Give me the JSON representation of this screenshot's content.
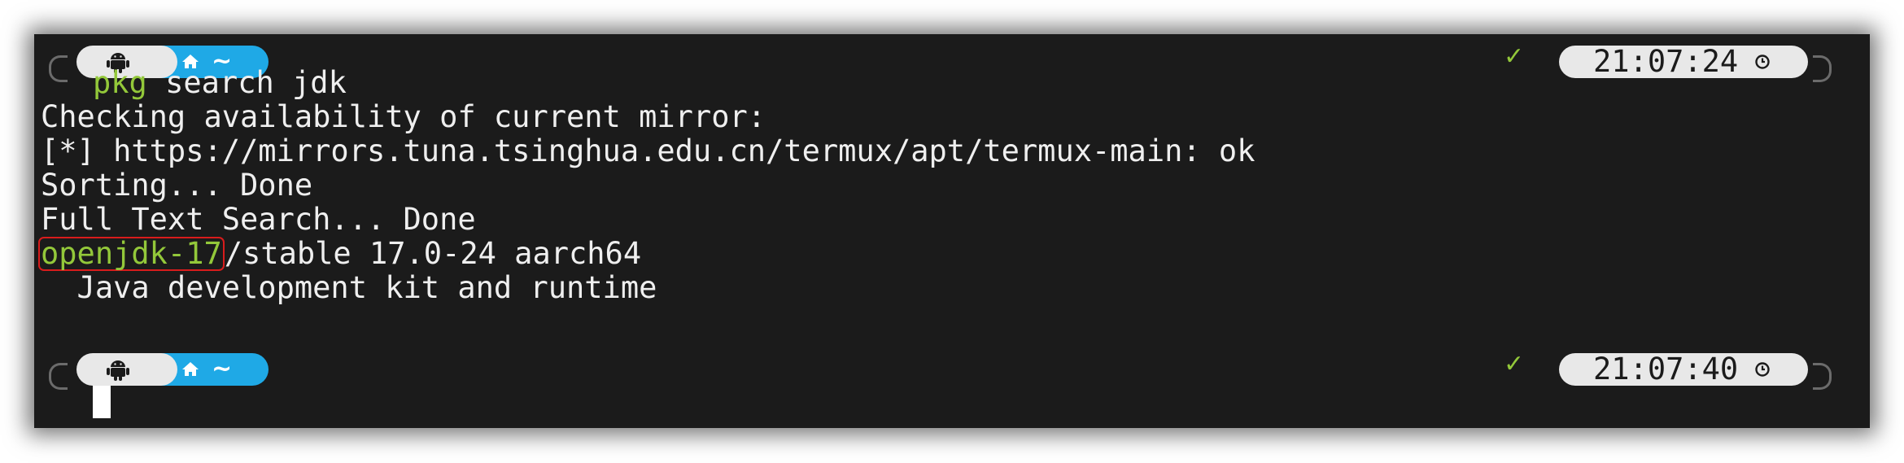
{
  "prompt1": {
    "icon_left": "android-icon",
    "icon_home": "home-icon",
    "directory": "~",
    "status_symbol": "✓",
    "time": "21:07:24",
    "time_icon": "clock-icon",
    "command_name": "pkg",
    "command_args": " search jdk"
  },
  "output": {
    "lines": [
      "Checking availability of current mirror:",
      "[*] https://mirrors.tuna.tsinghua.edu.cn/termux/apt/termux-main: ok",
      "Sorting... Done",
      "Full Text Search... Done"
    ],
    "result": {
      "package": "openjdk-17",
      "details": "/stable 17.0-24 aarch64",
      "description": "  Java development kit and runtime"
    }
  },
  "prompt2": {
    "icon_left": "android-icon",
    "icon_home": "home-icon",
    "directory": "~",
    "status_symbol": "✓",
    "time": "21:07:40",
    "time_icon": "clock-icon"
  },
  "colors": {
    "background": "#1b1b1b",
    "text": "#efefef",
    "accent_green": "#93c83a",
    "pill_blue": "#1fa9e6",
    "pill_light": "#e8e8e8",
    "highlight_red": "#d81c1c"
  }
}
